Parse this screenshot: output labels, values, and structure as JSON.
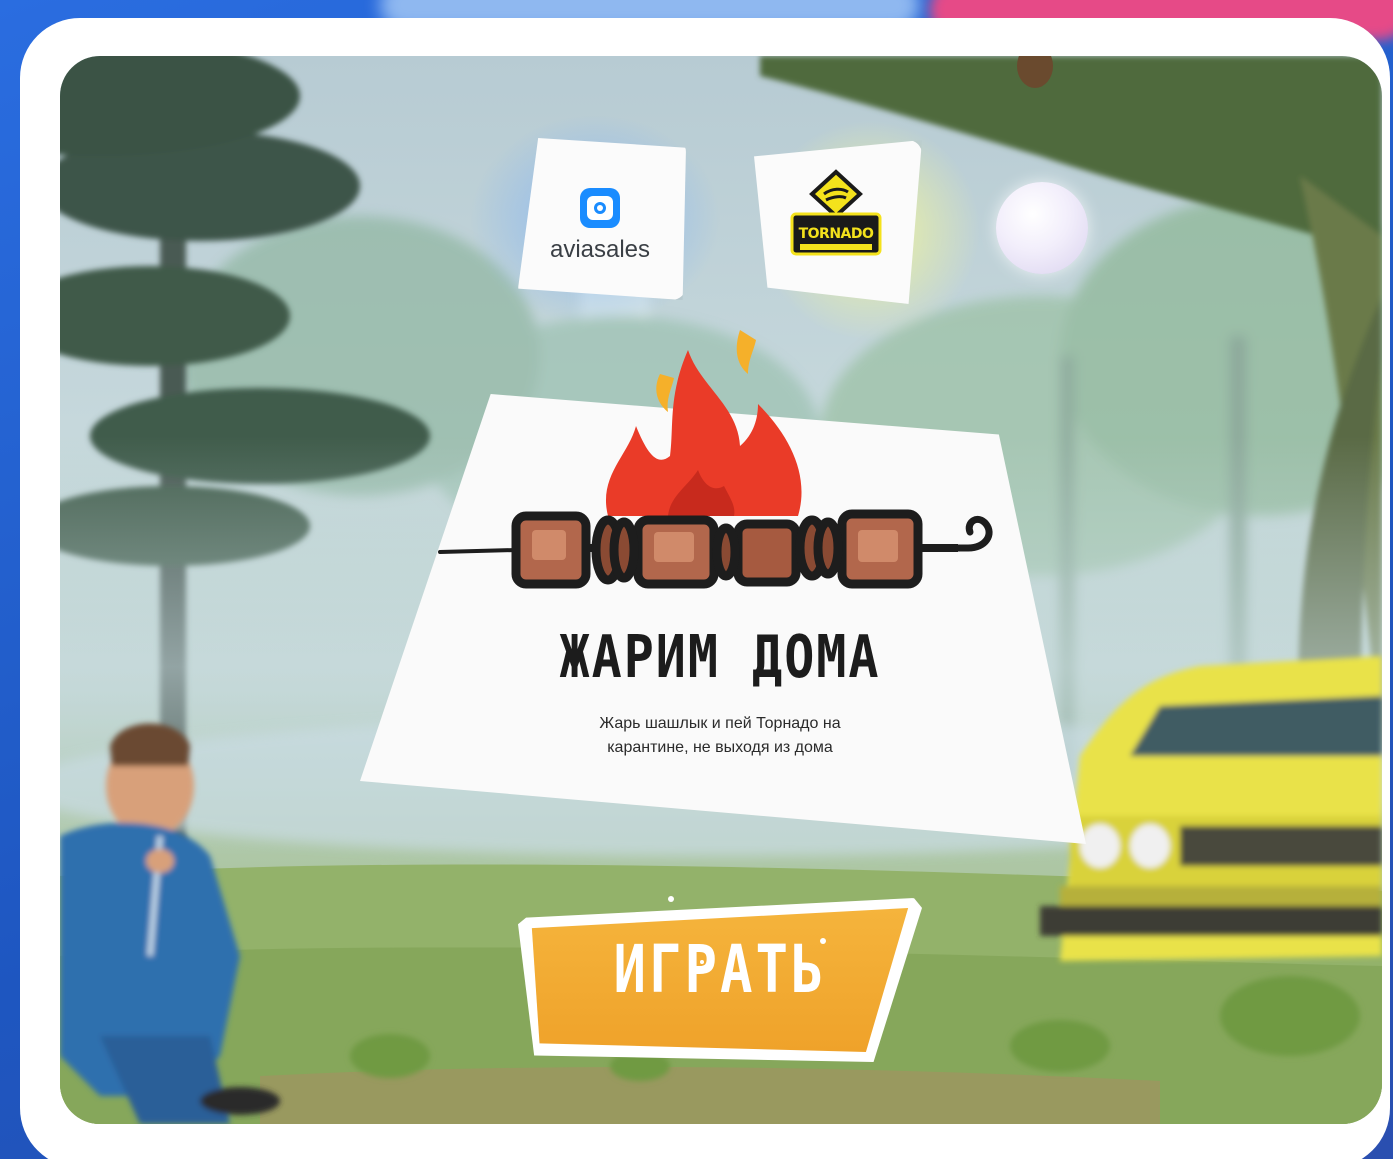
{
  "sponsors": {
    "aviasales": {
      "name": "aviasales",
      "icon": "aviasales-logo-icon",
      "color": "#1a8cff"
    },
    "tornado": {
      "name": "TORNADO",
      "icon": "tornado-logo-icon",
      "color": "#f4e21c"
    }
  },
  "card": {
    "title": "ЖАРИМ ДОМА",
    "subtitle_line1": "Жарь шашлык и пей Торнадо на",
    "subtitle_line2": "карантине, не выходя из дома"
  },
  "play_button": {
    "label": "ИГРАТЬ",
    "color": "#f0a52c"
  }
}
